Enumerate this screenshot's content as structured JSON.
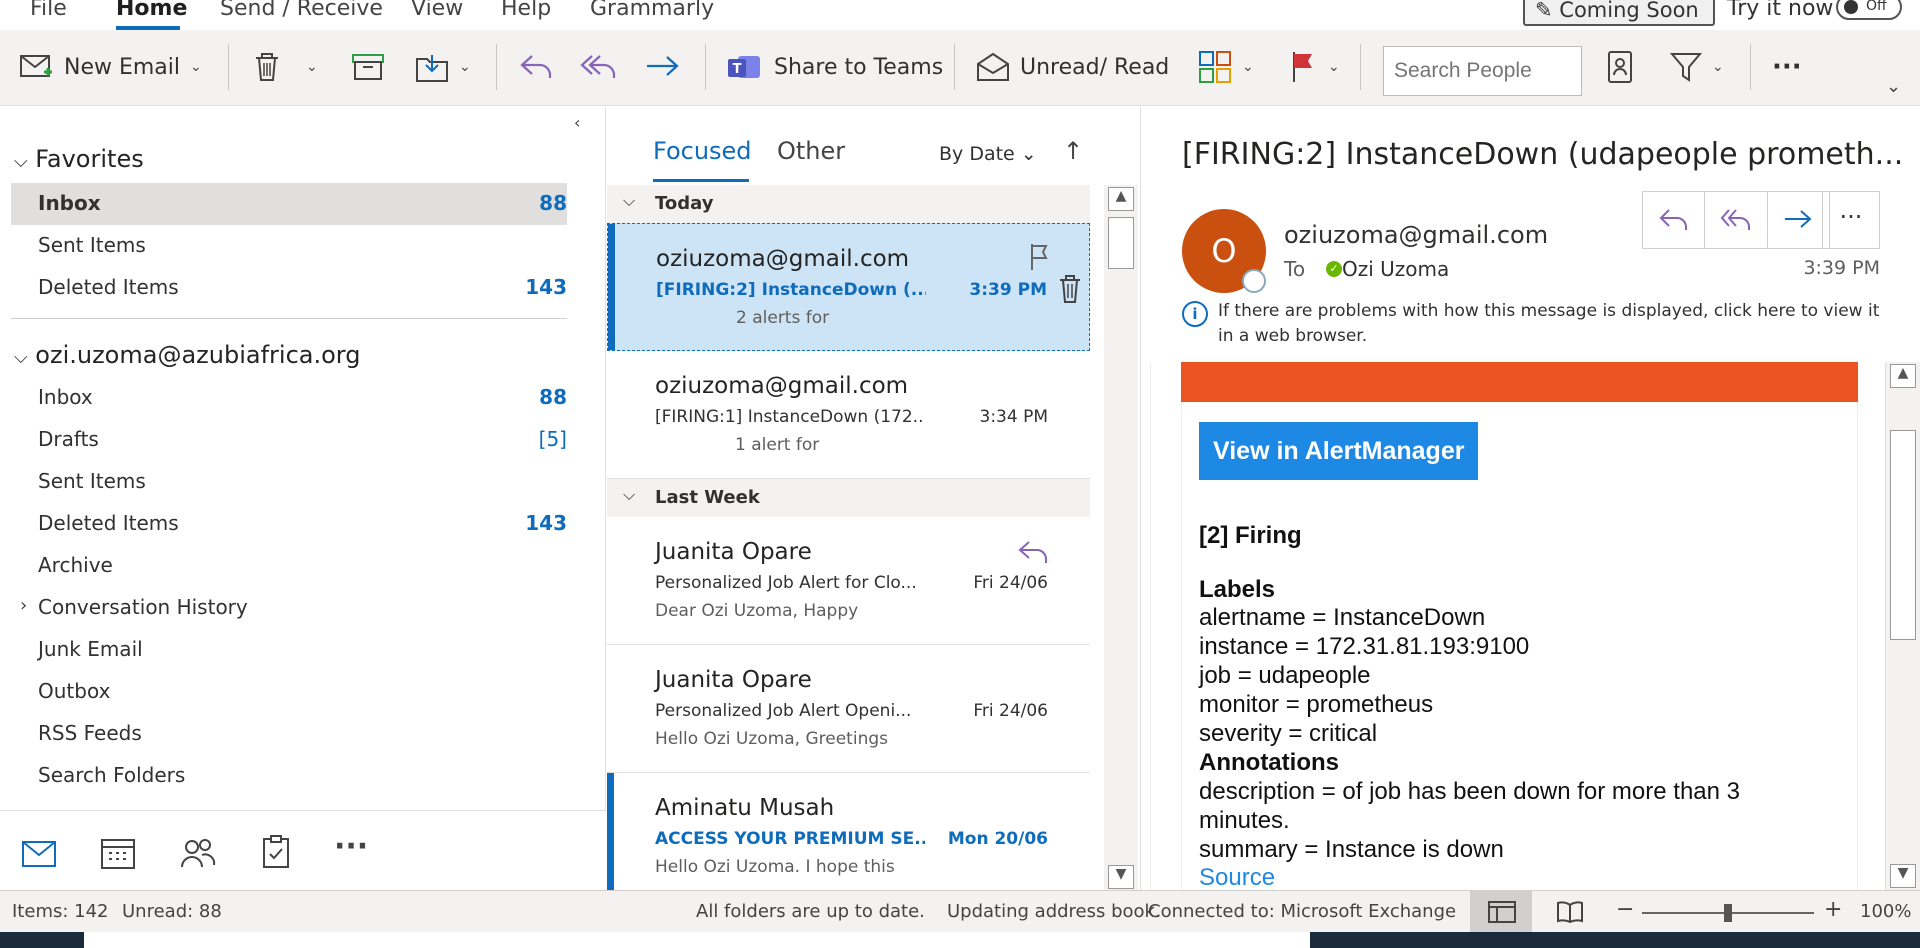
{
  "ribbon": {
    "tabs": [
      "File",
      "Home",
      "Send / Receive",
      "View",
      "Help",
      "Grammarly"
    ],
    "coming_soon": "Coming Soon",
    "try_now": "Try it now",
    "toggle": "Off"
  },
  "toolbar": {
    "new_email": "New Email",
    "share_teams": "Share to Teams",
    "unread_read": "Unread/ Read",
    "search_people_placeholder": "Search People",
    "more": "···"
  },
  "folders": {
    "favorites_header": "Favorites",
    "favorites": [
      {
        "label": "Inbox",
        "count": "88"
      },
      {
        "label": "Sent Items",
        "count": ""
      },
      {
        "label": "Deleted Items",
        "count": "143"
      }
    ],
    "account_header": "ozi.uzoma@azubiafrica.org",
    "account_items": [
      {
        "label": "Inbox",
        "count": "88"
      },
      {
        "label": "Drafts",
        "count": "[5]"
      },
      {
        "label": "Sent Items",
        "count": ""
      },
      {
        "label": "Deleted Items",
        "count": "143"
      },
      {
        "label": "Archive",
        "count": ""
      },
      {
        "label": "Conversation History",
        "count": ""
      },
      {
        "label": "Junk Email",
        "count": ""
      },
      {
        "label": "Outbox",
        "count": ""
      },
      {
        "label": "RSS Feeds",
        "count": ""
      },
      {
        "label": "Search Folders",
        "count": ""
      }
    ]
  },
  "list": {
    "tab_focused": "Focused",
    "tab_other": "Other",
    "sort": "By Date",
    "group_today": "Today",
    "group_last_week": "Last Week",
    "messages": [
      {
        "sender": "oziuzoma@gmail.com",
        "subject": "[FIRING:2] InstanceDown (...",
        "time": "3:39 PM",
        "preview": "2 alerts for"
      },
      {
        "sender": "oziuzoma@gmail.com",
        "subject": "[FIRING:1] InstanceDown (172...",
        "time": "3:34 PM",
        "preview": "1 alert for"
      },
      {
        "sender": "Juanita Opare",
        "subject": "Personalized Job Alert for Clo...",
        "time": "Fri 24/06",
        "preview": "Dear Ozi Uzoma,  Happy"
      },
      {
        "sender": "Juanita Opare",
        "subject": "Personalized Job Alert Openi...",
        "time": "Fri 24/06",
        "preview": "Hello Ozi Uzoma,  Greetings"
      },
      {
        "sender": "Aminatu Musah",
        "subject": "ACCESS YOUR PREMIUM SE...",
        "time": "Mon 20/06",
        "preview": "Hello Ozi Uzoma.  I hope this"
      }
    ]
  },
  "reading": {
    "subject": "[FIRING:2] InstanceDown (udapeople prometh...",
    "avatar_initial": "O",
    "from": "oziuzoma@gmail.com",
    "to_label": "To",
    "recipient": "Ozi Uzoma",
    "time": "3:39 PM",
    "info": "If there are problems with how this message is displayed, click here to view it in a web browser.",
    "info_icon": "i",
    "body": {
      "button": "View in AlertManager",
      "firing": "[2] Firing",
      "labels_header": "Labels",
      "lines": [
        "alertname = InstanceDown",
        "instance = 172.31.81.193:9100",
        "job = udapeople",
        "monitor = prometheus",
        "severity = critical"
      ],
      "annotations_header": "Annotations",
      "desc1": "description = of job has been down for more than 3",
      "desc2": "minutes.",
      "summary": "summary = Instance is down",
      "source": "Source"
    }
  },
  "status": {
    "items": "Items: 142",
    "unread": "Unread: 88",
    "sync": "All folders are up to date.",
    "updating": "Updating address book.",
    "connected": "Connected to: Microsoft Exchange",
    "zoom": "100%",
    "zoom_level": 0.5
  }
}
